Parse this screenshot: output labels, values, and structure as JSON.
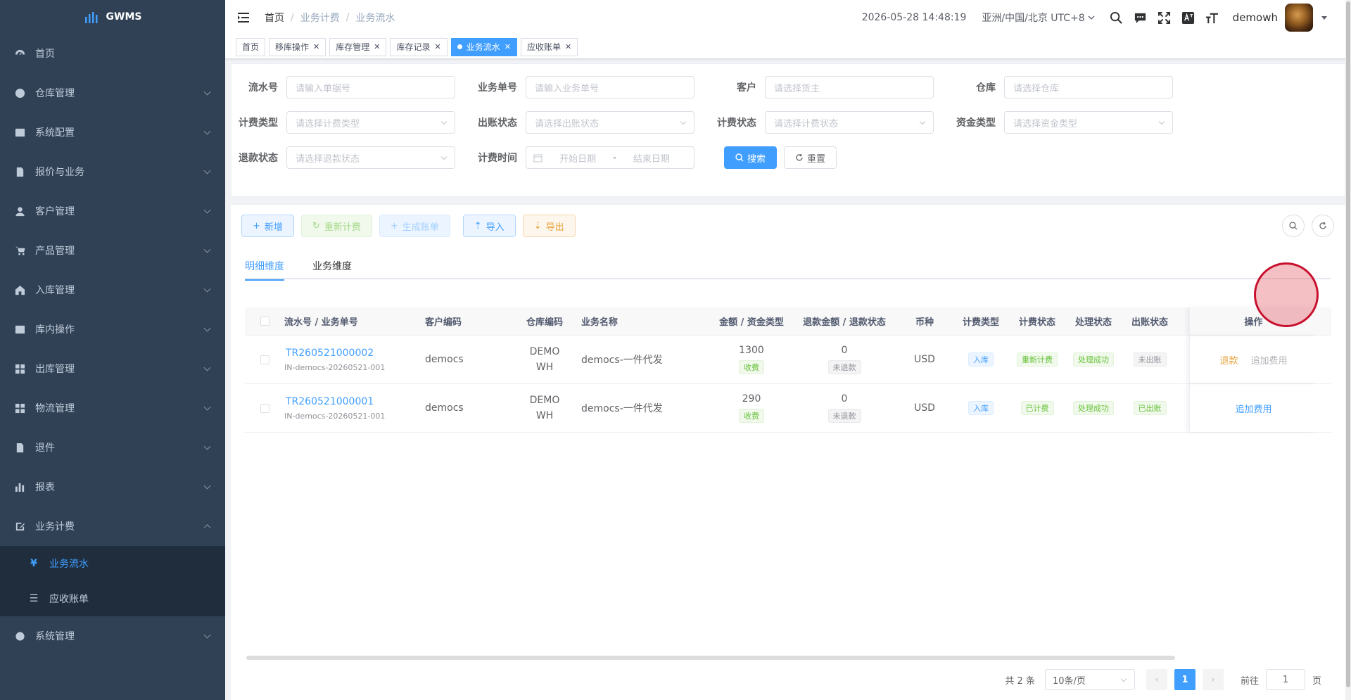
{
  "app": {
    "name": "GWMS"
  },
  "sidebar": {
    "items": [
      {
        "label": "首页",
        "icon": "dashboard-icon",
        "arrow": false
      },
      {
        "label": "仓库管理",
        "icon": "globe-icon",
        "arrow": true
      },
      {
        "label": "系统配置",
        "icon": "config-icon",
        "arrow": true
      },
      {
        "label": "报价与业务",
        "icon": "document-icon",
        "arrow": true
      },
      {
        "label": "客户管理",
        "icon": "user-icon",
        "arrow": true
      },
      {
        "label": "产品管理",
        "icon": "cart-icon",
        "arrow": true
      },
      {
        "label": "入库管理",
        "icon": "home-icon",
        "arrow": true
      },
      {
        "label": "库内操作",
        "icon": "table-icon",
        "arrow": true
      },
      {
        "label": "出库管理",
        "icon": "grid-icon",
        "arrow": true
      },
      {
        "label": "物流管理",
        "icon": "grid-icon",
        "arrow": true
      },
      {
        "label": "退件",
        "icon": "document-icon",
        "arrow": true
      },
      {
        "label": "报表",
        "icon": "bar-chart-icon",
        "arrow": true
      },
      {
        "label": "业务计费",
        "icon": "edit-icon",
        "arrow": true,
        "open": true
      },
      {
        "label": "系统管理",
        "icon": "gear-icon",
        "arrow": true
      }
    ],
    "sub_items": [
      {
        "label": "业务流水",
        "icon": "yen-icon",
        "active": true
      },
      {
        "label": "应收账单",
        "icon": "list-icon",
        "active": false
      }
    ]
  },
  "navbar": {
    "breadcrumb": [
      "首页",
      "业务计费",
      "业务流水"
    ],
    "datetime": "2026-05-28 14:48:19",
    "timezone": "亚洲/中国/北京 UTC+8",
    "username": "demowh"
  },
  "tags": [
    {
      "label": "首页",
      "closable": false,
      "active": false
    },
    {
      "label": "移库操作",
      "closable": true,
      "active": false
    },
    {
      "label": "库存管理",
      "closable": true,
      "active": false
    },
    {
      "label": "库存记录",
      "closable": true,
      "active": false
    },
    {
      "label": "业务流水",
      "closable": true,
      "active": true
    },
    {
      "label": "应收账单",
      "closable": true,
      "active": false
    }
  ],
  "filters": {
    "serial_no": {
      "label": "流水号",
      "placeholder": "请输入单据号"
    },
    "biz_no": {
      "label": "业务单号",
      "placeholder": "请输入业务单号"
    },
    "customer": {
      "label": "客户",
      "placeholder": "请选择货主"
    },
    "warehouse": {
      "label": "仓库",
      "placeholder": "请选择仓库"
    },
    "fee_type": {
      "label": "计费类型",
      "placeholder": "请选择计费类型"
    },
    "bill_status": {
      "label": "出账状态",
      "placeholder": "请选择出账状态"
    },
    "fee_status": {
      "label": "计费状态",
      "placeholder": "请选择计费状态"
    },
    "fund_type": {
      "label": "资金类型",
      "placeholder": "请选择资金类型"
    },
    "refund_status": {
      "label": "退款状态",
      "placeholder": "请选择退款状态"
    },
    "fee_time": {
      "label": "计费时间",
      "start_placeholder": "开始日期",
      "end_placeholder": "结束日期",
      "separator": "-"
    },
    "search_label": "搜索",
    "reset_label": "重置"
  },
  "toolbar": {
    "add": "新增",
    "recalc": "重新计费",
    "gen_bill": "生成账单",
    "import": "导入",
    "export": "导出"
  },
  "tabs": [
    {
      "label": "明细维度",
      "active": true
    },
    {
      "label": "业务维度",
      "active": false
    }
  ],
  "table": {
    "headers": [
      "流水号 / 业务单号",
      "客户编码",
      "仓库编码",
      "业务名称",
      "金额 / 资金类型",
      "退款金额 / 退款状态",
      "币种",
      "计费类型",
      "计费状态",
      "处理状态",
      "出账状态",
      "操作"
    ],
    "rows": [
      {
        "serial": "TR260521000002",
        "biz_no": "IN-democs-20260521-001",
        "customer": "democs",
        "warehouse": "DEMOWH",
        "biz_name": "democs-一件代发",
        "amount": "1300",
        "fund_type": "收费",
        "refund_amount": "0",
        "refund_status": "未退款",
        "currency": "USD",
        "fee_type": "入库",
        "fee_status": "重新计费",
        "proc_status": "处理成功",
        "bill_status": "未出账",
        "actions": [
          "退款",
          "追加费用"
        ]
      },
      {
        "serial": "TR260521000001",
        "biz_no": "IN-democs-20260521-001",
        "customer": "democs",
        "warehouse": "DEMOWH",
        "biz_name": "democs-一件代发",
        "amount": "290",
        "fund_type": "收费",
        "refund_amount": "0",
        "refund_status": "未退款",
        "currency": "USD",
        "fee_type": "入库",
        "fee_status": "已计费",
        "proc_status": "处理成功",
        "bill_status": "已出账",
        "actions": [
          "追加费用"
        ]
      }
    ]
  },
  "pagination": {
    "total": "共 2 条",
    "page_size": "10条/页",
    "current": "1",
    "goto_label": "前往",
    "goto_value": "1",
    "page_suffix": "页"
  }
}
